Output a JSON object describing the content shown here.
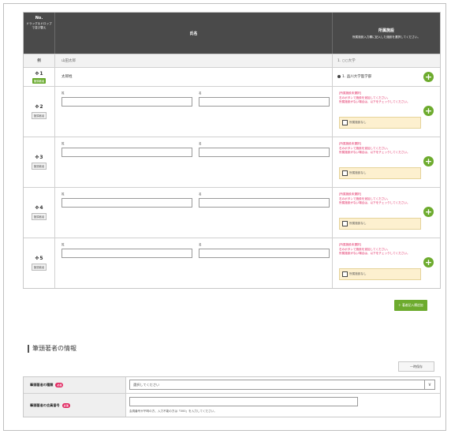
{
  "table": {
    "header": {
      "no": "No.",
      "no_sub": "ドラッグ＆ドロップで並び替え",
      "name": "氏名",
      "affiliation": "所属施設",
      "affiliation_sub": "所属施設入力欄に記入した施設を選択してください。"
    },
    "example": {
      "no": "例",
      "name": "山田太郎",
      "affiliation": "1. ○○大学"
    },
    "first": {
      "num": "1",
      "badge": "筆頭著者",
      "name": "太郎姓",
      "affiliation": "1. 品川大学医学部"
    },
    "rows": [
      {
        "num": "2",
        "badge": "筆頭著者"
      },
      {
        "num": "3",
        "badge": "筆頭著者"
      },
      {
        "num": "4",
        "badge": "筆頭著者"
      },
      {
        "num": "5",
        "badge": "筆頭著者"
      }
    ],
    "labels": {
      "last": "姓",
      "first": "名"
    },
    "warning": "[所属施設未選択]\n右のボタンで施設を追加してください。\n所属施設がない場合は、以下をチェックしてください。",
    "no_affiliation": "所属施設なし",
    "add_icon": "+"
  },
  "add_author_button": "＋ 著者記入欄追加",
  "section": {
    "title": "筆頭著者の情報",
    "temp_save": "一時保存"
  },
  "form": {
    "type_label": "筆頭著者の種類",
    "type_placeholder": "選択してください",
    "member_label": "筆頭著者の会員番号",
    "member_hint": "会員番号が不明の方、入力不能の方は「000」を入力してください。",
    "required": "必須",
    "dropdown_arrow": "∨"
  },
  "colors": {
    "accent": "#6dab2e",
    "warning": "#e0245e",
    "header_bg": "#4a4a4a",
    "note_bg": "#fdf0cf"
  }
}
